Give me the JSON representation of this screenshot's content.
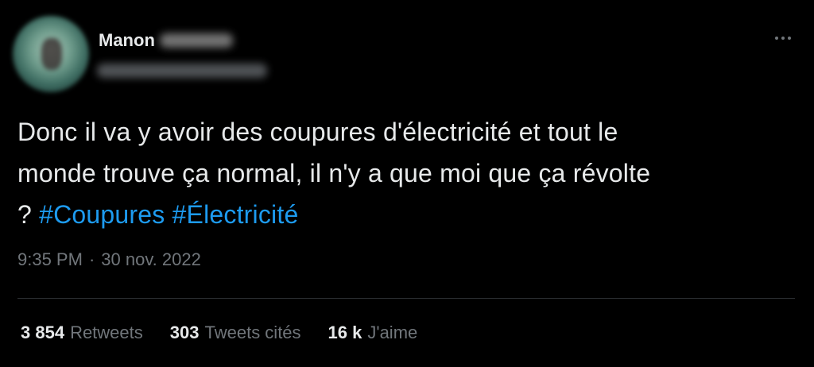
{
  "tweet": {
    "author": {
      "display_name": "Manon"
    },
    "text_line1": "Donc il va y avoir des coupures d'électricité et tout le",
    "text_line2": "monde trouve ça normal, il n'y a que moi que ça révolte",
    "text_line3_prefix": "? ",
    "hashtags": [
      "#Coupures",
      "#Électricité"
    ],
    "time": "9:35 PM",
    "separator": "·",
    "date": "30 nov. 2022",
    "stats": [
      {
        "count": "3 854",
        "label": "Retweets"
      },
      {
        "count": "303",
        "label": "Tweets cités"
      },
      {
        "count": "16 k",
        "label": "J'aime"
      }
    ]
  },
  "colors": {
    "background": "#000000",
    "text": "#e7e9ea",
    "muted": "#71767b",
    "hashtag": "#1d9bf0",
    "divider": "#2f3336"
  },
  "icons": {
    "more": "more-horizontal-icon"
  }
}
